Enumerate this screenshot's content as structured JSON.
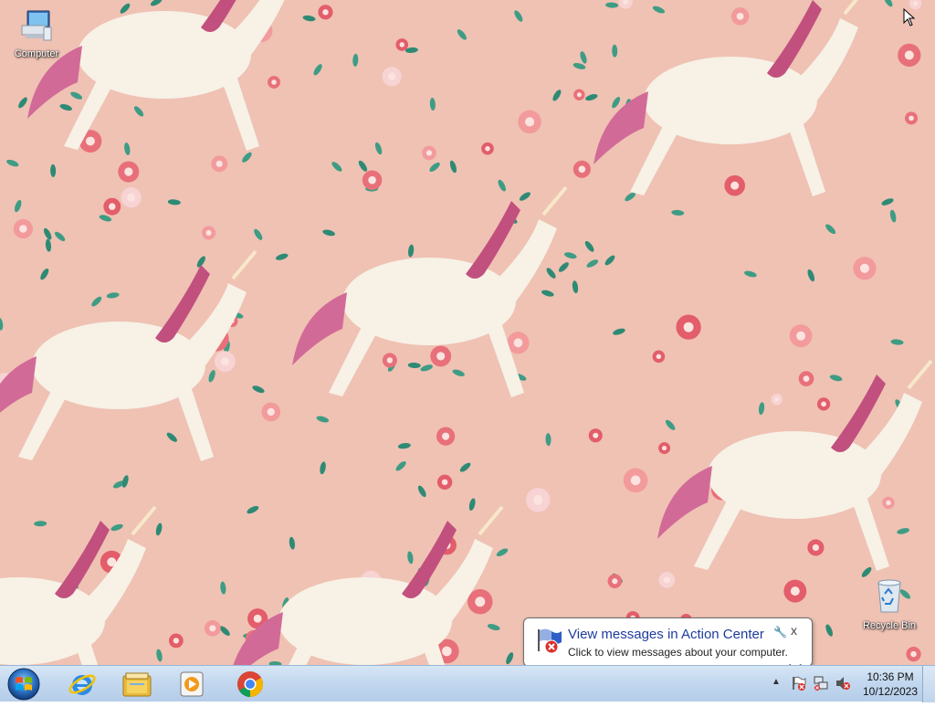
{
  "desktop": {
    "icons": [
      {
        "label": "Computer",
        "icon": "computer-icon"
      },
      {
        "label": "Recycle Bin",
        "icon": "recycle-bin-icon"
      }
    ]
  },
  "balloon": {
    "title": "View messages in Action Center",
    "body": "Click to view messages about your computer.",
    "close_glyph": "x",
    "options_glyph": "🔧"
  },
  "taskbar": {
    "pinned": [
      {
        "name": "Internet Explorer",
        "icon": "internet-explorer-icon"
      },
      {
        "name": "Windows Explorer",
        "icon": "windows-explorer-icon"
      },
      {
        "name": "Windows Media Player",
        "icon": "media-player-icon"
      },
      {
        "name": "Google Chrome",
        "icon": "chrome-icon"
      }
    ],
    "tray": {
      "show_hidden_glyph": "▲",
      "time": "10:36 PM",
      "date": "10/12/2023"
    }
  },
  "colors": {
    "taskbar": "#c3d8ef",
    "wallpaper_bg": "#efc2b4",
    "balloon_title": "#1e3c9e"
  }
}
